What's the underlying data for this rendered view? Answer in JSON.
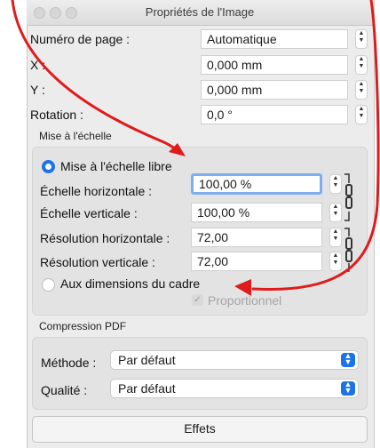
{
  "window": {
    "title": "Propriétés de l'Image"
  },
  "page": {
    "label": "Numéro de page :",
    "value": "Automatique"
  },
  "x": {
    "label": "X :",
    "value": "0,000 mm"
  },
  "y": {
    "label": "Y :",
    "value": "0,000 mm"
  },
  "rotation": {
    "label": "Rotation :",
    "value": "0,0 °"
  },
  "scale_section": {
    "title": "Mise à l'échelle",
    "free_scale_label": "Mise à l'échelle libre",
    "h_scale_label": "Échelle horizontale :",
    "h_scale_value": "100,00 %",
    "v_scale_label": "Échelle verticale :",
    "v_scale_value": "100,00 %",
    "h_res_label": "Résolution horizontale :",
    "h_res_value": "72,00",
    "v_res_label": "Résolution verticale :",
    "v_res_value": "72,00",
    "frame_label": "Aux dimensions du cadre",
    "proportional_label": "Proportionnel"
  },
  "pdf_section": {
    "title": "Compression PDF",
    "method_label": "Méthode :",
    "method_value": "Par défaut",
    "quality_label": "Qualité :",
    "quality_value": "Par défaut"
  },
  "effects_button": "Effets",
  "colors": {
    "accent": "#1a73e8",
    "annotation": "#e01b1b"
  }
}
